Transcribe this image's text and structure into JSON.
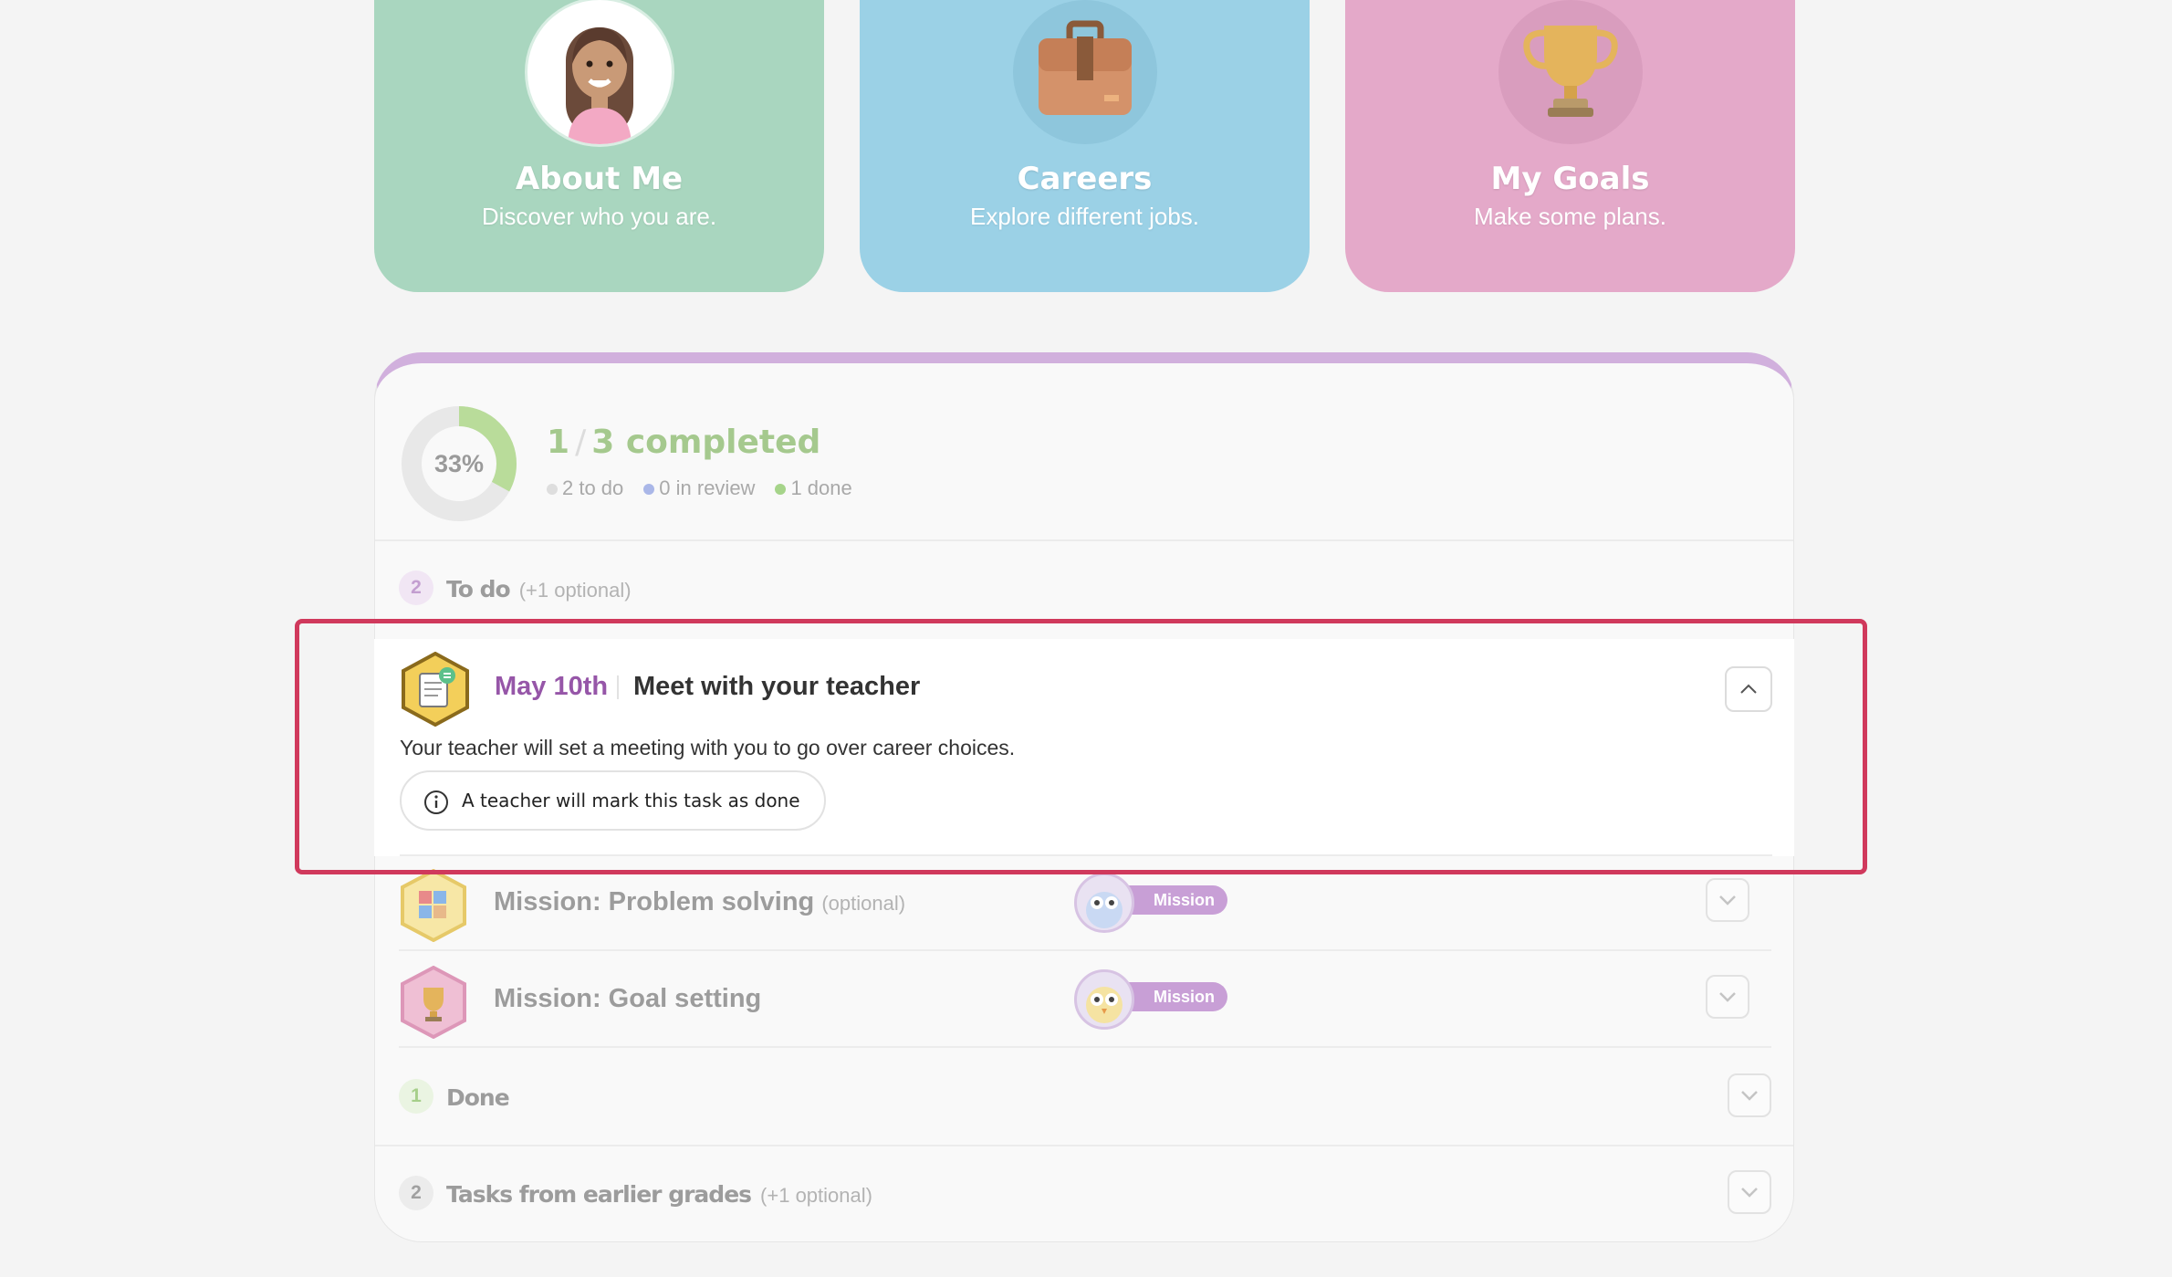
{
  "cards": [
    {
      "title": "About Me",
      "subtitle": "Discover who you are.",
      "icon": "avatar-girl-icon",
      "color": "#a9d6bf"
    },
    {
      "title": "Careers",
      "subtitle": "Explore different jobs.",
      "icon": "briefcase-icon",
      "color": "#9bd1e6"
    },
    {
      "title": "My Goals",
      "subtitle": "Make some plans.",
      "icon": "trophy-icon",
      "color": "#e4a9c9"
    }
  ],
  "progress": {
    "percent_label": "33%",
    "percent_value": 0.33,
    "done_count": "1",
    "total_count": "3",
    "completed_word": "completed",
    "todo": "2 to do",
    "review": "0 in review",
    "done": "1 done"
  },
  "sections": {
    "todo": {
      "count": "2",
      "title": "To do",
      "note": "(+1 optional)"
    },
    "done": {
      "count": "1",
      "title": "Done"
    },
    "earlier": {
      "count": "2",
      "title": "Tasks from earlier grades",
      "note": "(+1 optional)"
    }
  },
  "expanded_task": {
    "date": "May 10th",
    "title": "Meet with your teacher",
    "description": "Your teacher will set a meeting with you to go over career choices.",
    "info": "A teacher will mark this task as done"
  },
  "tasks": [
    {
      "title": "Mission: Problem solving",
      "note": "(optional)",
      "tag": "Mission"
    },
    {
      "title": "Mission: Goal setting",
      "note": "",
      "tag": "Mission"
    }
  ],
  "colors": {
    "accent_purple": "#9656a8",
    "highlight": "#d0395c",
    "progress_green": "#a5c98e"
  }
}
